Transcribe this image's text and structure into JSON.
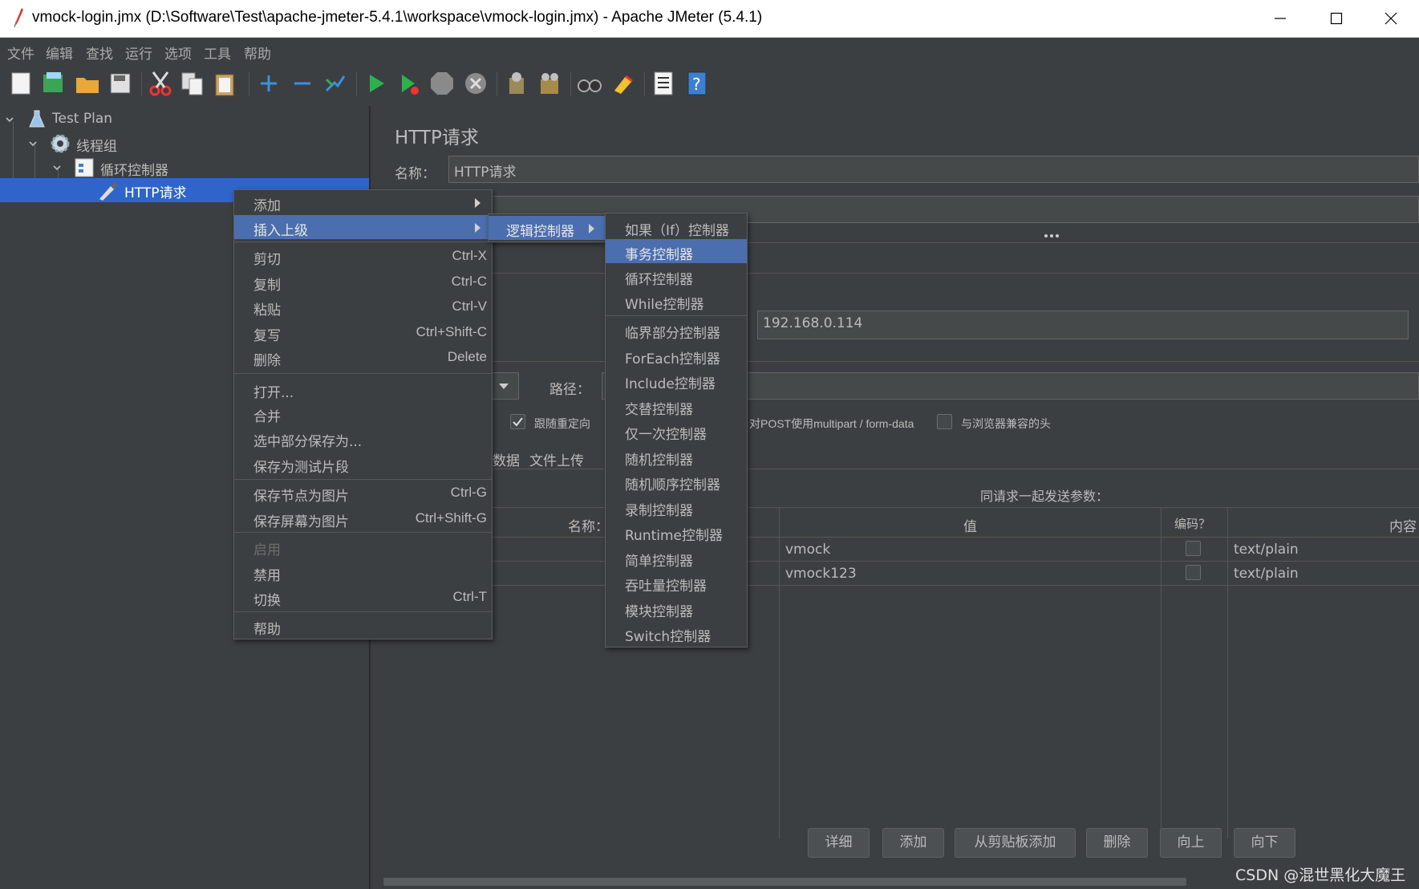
{
  "window": {
    "title": "vmock-login.jmx (D:\\Software\\Test\\apache-jmeter-5.4.1\\workspace\\vmock-login.jmx) - Apache JMeter (5.4.1)"
  },
  "menubar": [
    "文件",
    "编辑",
    "查找",
    "运行",
    "选项",
    "工具",
    "帮助"
  ],
  "tree": {
    "items": [
      {
        "label": "Test Plan",
        "icon": "flask-icon"
      },
      {
        "label": "线程组",
        "icon": "gear-icon"
      },
      {
        "label": "循环控制器",
        "icon": "loop-controller-icon"
      },
      {
        "label": "HTTP请求",
        "icon": "pipette-icon"
      }
    ]
  },
  "panel": {
    "title": "HTTP请求",
    "name_label": "名称：",
    "name_value": "HTTP请求",
    "server_value": "192.168.0.114",
    "path_label": "路径：",
    "follow_redirects_label": "跟随重定向",
    "multipart_label": "对POST使用multipart / form-data",
    "browser_headers_label": "与浏览器兼容的头",
    "tab_data": "数据",
    "tab_upload": "文件上传",
    "params_title": "同请求一起发送参数：",
    "columns": {
      "name": "名称：",
      "value": "值",
      "encode": "编码？",
      "content": "内容"
    },
    "rows": [
      {
        "value": "vmock",
        "content": "text/plain"
      },
      {
        "value": "vmock123",
        "content": "text/plain"
      }
    ],
    "buttons": [
      "详细",
      "添加",
      "从剪贴板添加",
      "删除",
      "向上",
      "向下"
    ]
  },
  "context_menu": {
    "items": [
      {
        "label": "添加",
        "shortcut": "",
        "submenu": true
      },
      {
        "label": "插入上级",
        "shortcut": "",
        "submenu": true
      },
      {
        "label": "剪切",
        "shortcut": "Ctrl-X"
      },
      {
        "label": "复制",
        "shortcut": "Ctrl-C"
      },
      {
        "label": "粘贴",
        "shortcut": "Ctrl-V"
      },
      {
        "label": "复写",
        "shortcut": "Ctrl+Shift-C"
      },
      {
        "label": "删除",
        "shortcut": "Delete"
      },
      {
        "label": "打开...",
        "shortcut": ""
      },
      {
        "label": "合并",
        "shortcut": ""
      },
      {
        "label": "选中部分保存为...",
        "shortcut": ""
      },
      {
        "label": "保存为测试片段",
        "shortcut": ""
      },
      {
        "label": "保存节点为图片",
        "shortcut": "Ctrl-G"
      },
      {
        "label": "保存屏幕为图片",
        "shortcut": "Ctrl+Shift-G"
      },
      {
        "label": "启用",
        "shortcut": ""
      },
      {
        "label": "禁用",
        "shortcut": ""
      },
      {
        "label": "切换",
        "shortcut": "Ctrl-T"
      },
      {
        "label": "帮助",
        "shortcut": ""
      }
    ]
  },
  "submenu1": {
    "items": [
      "逻辑控制器"
    ]
  },
  "submenu2": {
    "items": [
      "如果（If）控制器",
      "事务控制器",
      "循环控制器",
      "While控制器",
      "临界部分控制器",
      "ForEach控制器",
      "Include控制器",
      "交替控制器",
      "仅一次控制器",
      "随机控制器",
      "随机顺序控制器",
      "录制控制器",
      "Runtime控制器",
      "简单控制器",
      "吞吐量控制器",
      "模块控制器",
      "Switch控制器"
    ]
  },
  "watermark": "CSDN @混世黑化大魔王",
  "colors": {
    "selection": "#4b6eaf",
    "background": "#3c3f41",
    "field": "#45494a"
  }
}
